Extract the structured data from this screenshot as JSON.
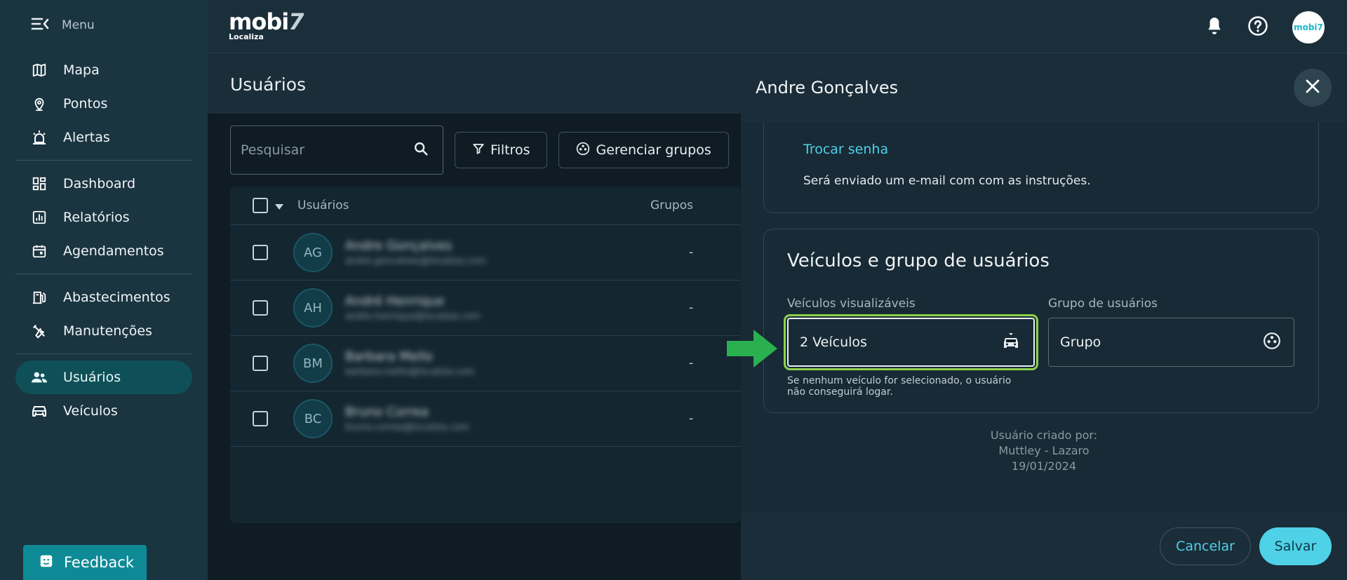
{
  "sidebar": {
    "menu_label": "Menu",
    "items": [
      {
        "label": "Mapa",
        "icon": "map-icon"
      },
      {
        "label": "Pontos",
        "icon": "location-pin-icon"
      },
      {
        "label": "Alertas",
        "icon": "siren-icon"
      },
      {
        "label": "Dashboard",
        "icon": "dashboard-icon"
      },
      {
        "label": "Relatórios",
        "icon": "reports-icon"
      },
      {
        "label": "Agendamentos",
        "icon": "calendar-icon"
      },
      {
        "label": "Abastecimentos",
        "icon": "fuel-icon"
      },
      {
        "label": "Manutenções",
        "icon": "tools-icon"
      },
      {
        "label": "Usuários",
        "icon": "users-icon",
        "active": true
      },
      {
        "label": "Veículos",
        "icon": "car-icon"
      }
    ],
    "feedback_label": "Feedback"
  },
  "topbar": {
    "brand": "mobi",
    "brand_seven": "7",
    "brand_sub": "Localiza",
    "avatar_text": "mobi7"
  },
  "main": {
    "title": "Usuários",
    "search_placeholder": "Pesquisar",
    "filters_label": "Filtros",
    "groups_label": "Gerenciar grupos",
    "table": {
      "col_users": "Usuários",
      "col_groups": "Grupos",
      "rows": [
        {
          "initials": "AG",
          "name": "Andre Gonçalves",
          "email": "andre.goncalves@localiza.com",
          "group": "-"
        },
        {
          "initials": "AH",
          "name": "André Henrique",
          "email": "andre.henrique@localiza.com",
          "group": "-"
        },
        {
          "initials": "BM",
          "name": "Barbara Mello",
          "email": "barbara.mello@localiza.com",
          "group": "-"
        },
        {
          "initials": "BC",
          "name": "Bruno Correa",
          "email": "bruno.correa@localiza.com",
          "group": "-"
        }
      ]
    }
  },
  "drawer": {
    "title": "Andre Gonçalves",
    "change_password": "Trocar senha",
    "change_password_hint": "Será enviado um e-mail com com as instruções.",
    "section_title": "Veículos e grupo de usuários",
    "vehicles_label": "Veículos visualizáveis",
    "vehicles_value": "2 Veículos",
    "vehicles_hint": "Se nenhum veículo for selecionado, o usuário não conseguirá logar.",
    "group_label": "Grupo de usuários",
    "group_value": "Grupo",
    "created_by_label": "Usuário criado por:",
    "created_by_name": "Muttley - Lazaro",
    "created_date": "19/01/2024",
    "cancel_label": "Cancelar",
    "save_label": "Salvar"
  },
  "colors": {
    "accent": "#4fd1e8",
    "highlight": "#8ed14b",
    "arrow": "#2bb04f"
  }
}
